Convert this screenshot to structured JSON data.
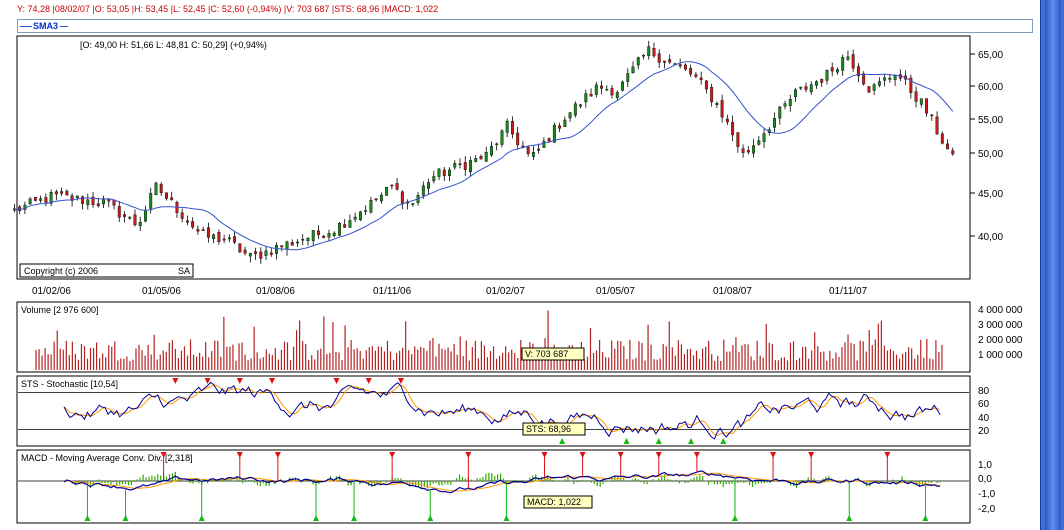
{
  "info_bar": {
    "text": "Y: 74,28 |08/02/07 |O: 53,05 |H: 53,45 |L: 52,45 |C: 52,60 (-0,94%) |V: 703 687 |STS: 68,96 |MACD: 1,022"
  },
  "legend": {
    "sma_label": "SMA3"
  },
  "colors": {
    "up_candle": "#1a8a1a",
    "down_candle": "#cc1a1a",
    "sma_line": "#3355cc",
    "volume_bar": "#b22222",
    "stoch_k": "#000099",
    "stoch_d": "#ff9900",
    "macd_line": "#000099",
    "signal_line": "#ff9900",
    "histogram": "#33aa00",
    "sell_marker": "#dd1111",
    "buy_marker": "#11bb11",
    "tag_bg": "#ffffc0"
  },
  "price_panel": {
    "ohlc_text": "[O: 49,00  H: 51,66  L: 48,81  C: 50,29] (+0,94%)",
    "copyright": "Copyright (c) 2006",
    "copyright_suffix": "SA",
    "y_ticks": [
      "65,00",
      "60,00",
      "55,00",
      "50,00",
      "45,00",
      "40,00"
    ],
    "x_ticks": [
      "01/02/06",
      "01/05/06",
      "01/08/06",
      "01/11/06",
      "01/02/07",
      "01/05/07",
      "01/08/07",
      "01/11/07"
    ]
  },
  "volume_panel": {
    "title": "Volume [2 976 600]",
    "y_ticks": [
      "4 000 000",
      "3 000 000",
      "2 000 000",
      "1 000 000"
    ],
    "tag": "V: 703 687"
  },
  "stoch_panel": {
    "title": "STS - Stochastic [10,54]",
    "y_ticks": [
      "80",
      "60",
      "40",
      "20"
    ],
    "tag": "STS: 68,96"
  },
  "macd_panel": {
    "title": "MACD - Moving Average Conv. Div. [2,318]",
    "y_ticks": [
      "1,0",
      "0,0",
      "-1,0",
      "-2,0"
    ],
    "tag": "MACD: 1,022"
  },
  "chart_data": {
    "type": "candlestick",
    "x": [
      "01/02/06",
      "01/05/06",
      "01/08/06",
      "01/11/06",
      "01/02/07",
      "01/05/07",
      "01/08/07",
      "01/11/07"
    ],
    "series": [
      {
        "name": "SMA3",
        "note": "moving average overlay"
      }
    ],
    "price_path": [
      {
        "date": "01/01/06",
        "close": 43.5
      },
      {
        "date": "01/02/06",
        "close": 45.5
      },
      {
        "date": "15/03/06",
        "close": 44.5
      },
      {
        "date": "10/04/06",
        "close": 41.5
      },
      {
        "date": "25/04/06",
        "close": 46.8
      },
      {
        "date": "10/05/06",
        "close": 44.0
      },
      {
        "date": "01/06/06",
        "close": 40.0
      },
      {
        "date": "20/06/06",
        "close": 39.5
      },
      {
        "date": "10/07/06",
        "close": 37.0
      },
      {
        "date": "01/08/06",
        "close": 38.5
      },
      {
        "date": "15/09/06",
        "close": 41.0
      },
      {
        "date": "15/10/06",
        "close": 44.5
      },
      {
        "date": "01/11/06",
        "close": 46.8
      },
      {
        "date": "15/11/06",
        "close": 44.0
      },
      {
        "date": "01/12/06",
        "close": 48.0
      },
      {
        "date": "15/01/07",
        "close": 51.0
      },
      {
        "date": "01/02/07",
        "close": 55.0
      },
      {
        "date": "20/02/07",
        "close": 50.5
      },
      {
        "date": "20/03/07",
        "close": 56.5
      },
      {
        "date": "15/04/07",
        "close": 60.5
      },
      {
        "date": "01/05/07",
        "close": 60.0
      },
      {
        "date": "25/05/07",
        "close": 65.5
      },
      {
        "date": "01/07/07",
        "close": 62.0
      },
      {
        "date": "20/07/07",
        "close": 58.0
      },
      {
        "date": "10/08/07",
        "close": 51.0
      },
      {
        "date": "01/09/07",
        "close": 55.5
      },
      {
        "date": "20/09/07",
        "close": 59.5
      },
      {
        "date": "15/10/07",
        "close": 62.0
      },
      {
        "date": "01/11/07",
        "close": 65.0
      },
      {
        "date": "20/11/07",
        "close": 60.0
      },
      {
        "date": "10/12/07",
        "close": 62.5
      },
      {
        "date": "01/01/08",
        "close": 58.0
      },
      {
        "date": "25/01/08",
        "close": 50.5
      }
    ],
    "y_axis": {
      "ticks": [
        65,
        60,
        55,
        50,
        45,
        40
      ],
      "range": [
        35.5,
        67.5
      ]
    },
    "grid": false
  }
}
